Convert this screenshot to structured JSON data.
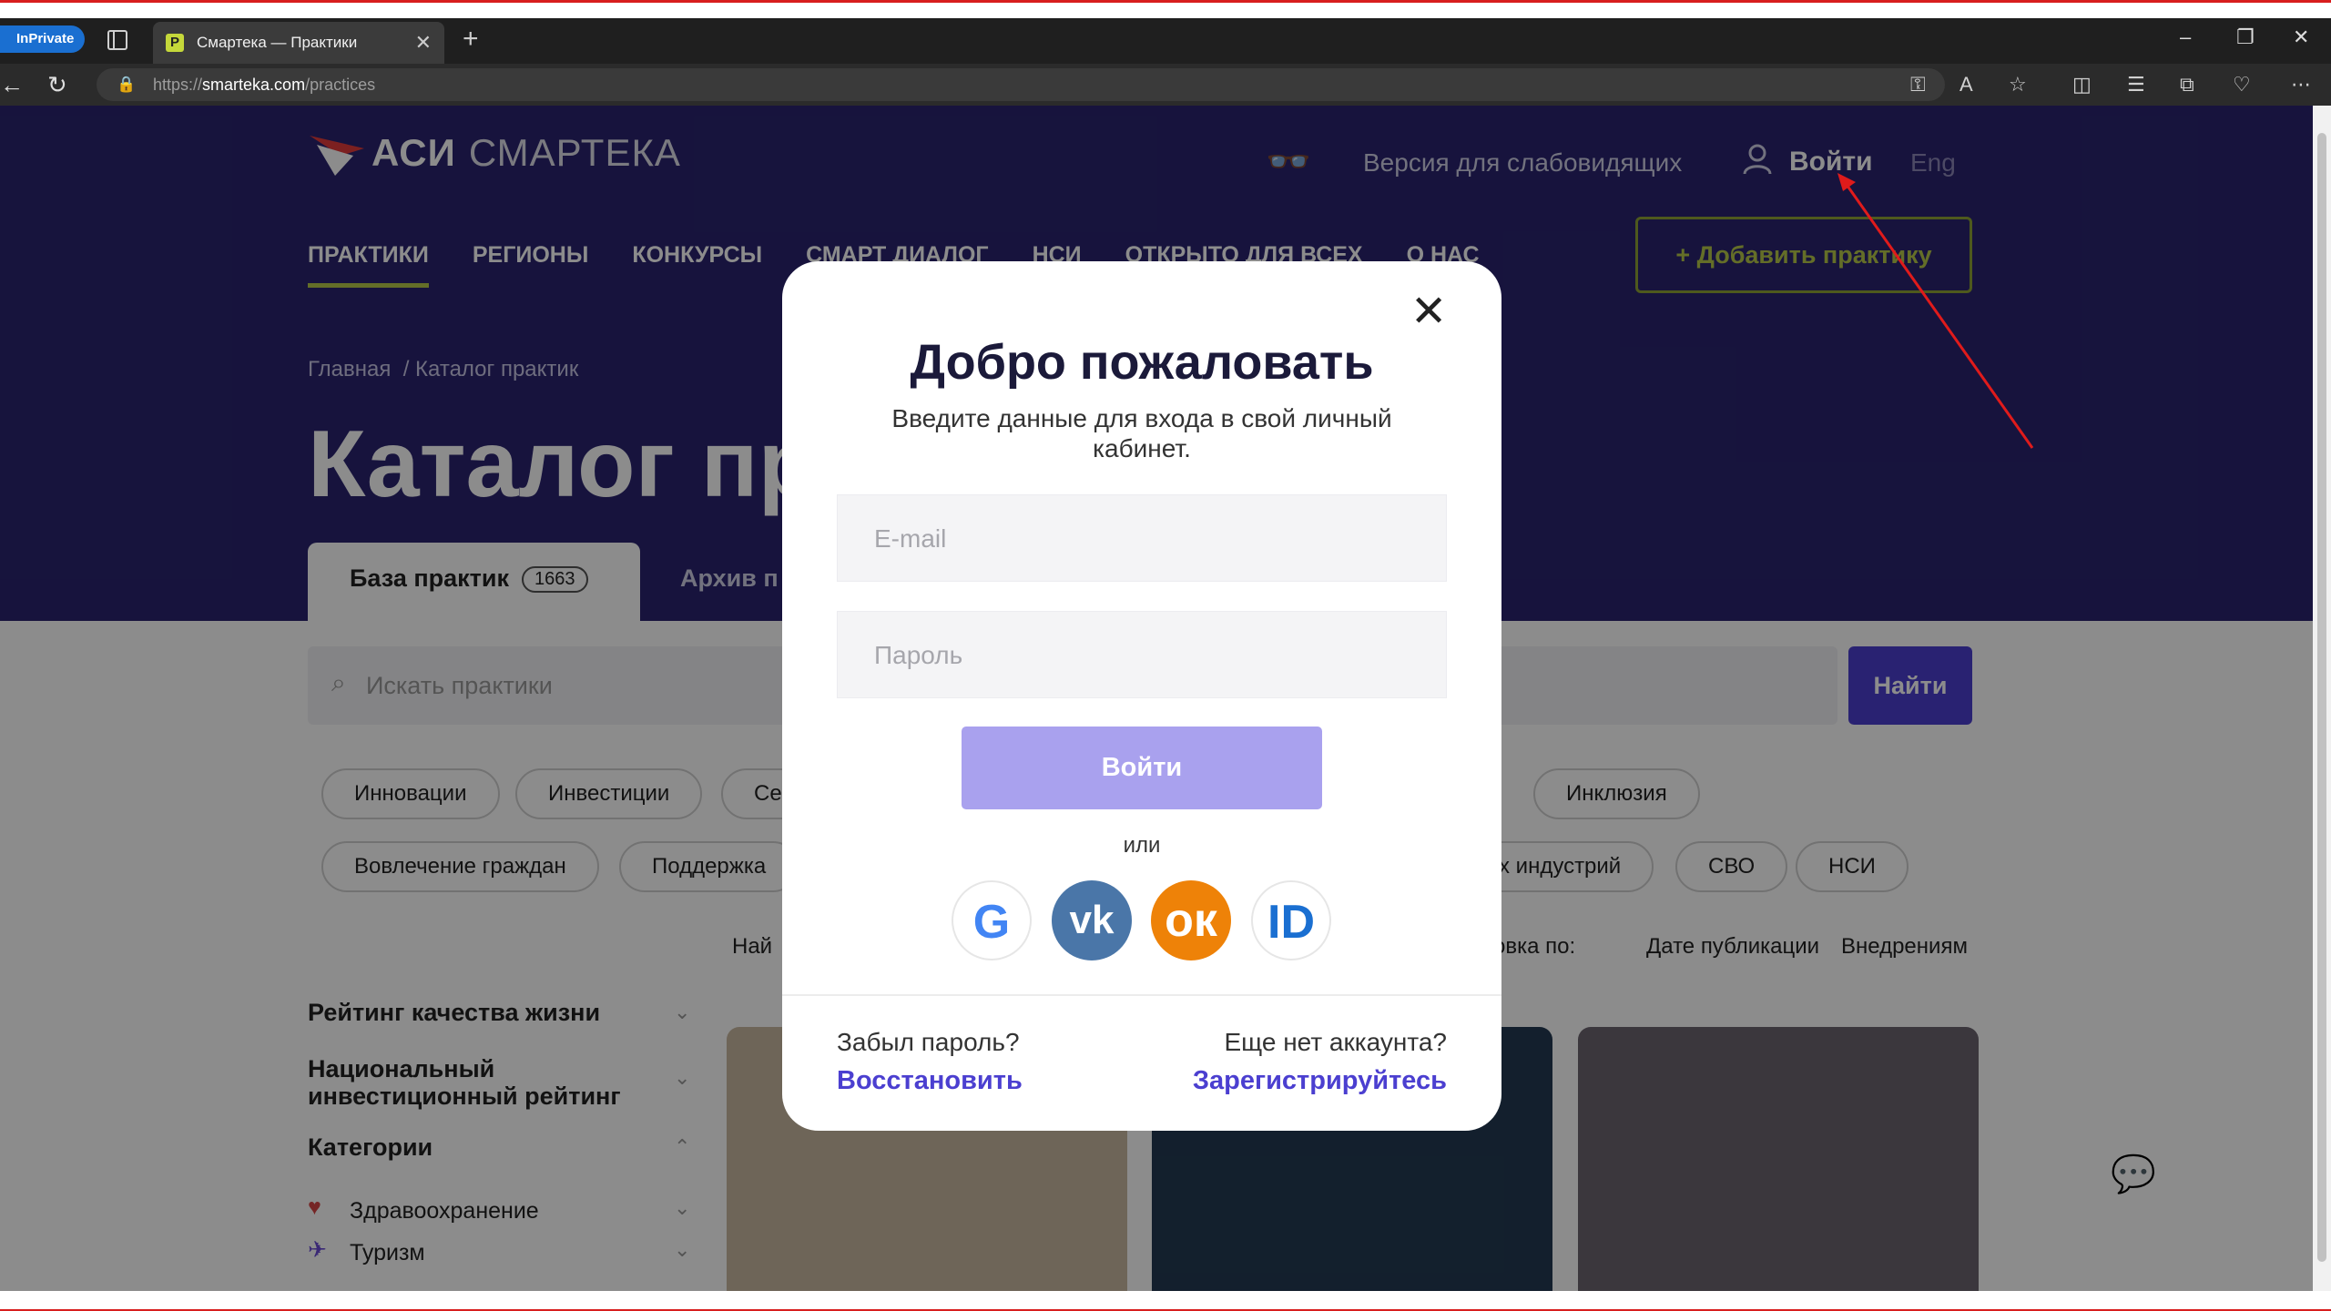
{
  "browser": {
    "inprivate_label": "InPrivate",
    "tab_title": "Смартека — Практики",
    "url_prefix": "https://",
    "url_host": "smarteka.com",
    "url_path": "/practices"
  },
  "header": {
    "logo_main": "АСИ",
    "logo_sub": "СМАРТЕКА",
    "accessibility_label": "Версия для слабовидящих",
    "login_label": "Войти",
    "lang_label": "Eng",
    "add_practice_label": "+ Добавить практику",
    "menu": [
      "ПРАКТИКИ",
      "РЕГИОНЫ",
      "КОНКУРСЫ",
      "СМАРТ ДИАЛОГ",
      "НСИ",
      "ОТКРЫТО ДЛЯ ВСЕХ",
      "О НАС"
    ]
  },
  "main": {
    "breadcrumb_home": "Главная",
    "breadcrumb_current": "/ Каталог практик",
    "title": "Каталог пр",
    "tab_base": "База практик",
    "tab_base_count": "1663",
    "tab_archive": "Архив п",
    "search_placeholder": "Искать практики",
    "search_button": "Найти",
    "chips_row1": [
      "Инновации",
      "Инвестиции",
      "Се",
      "Инклюзия"
    ],
    "chips_row2": [
      "Вовлечение граждан",
      "Поддержка",
      "х индустрий",
      "СВО",
      "НСИ"
    ],
    "found_prefix": "Най",
    "sort_label": "овка по:",
    "sort_date": "Дате публикации",
    "sort_impl": "Внедрениям"
  },
  "sidebar": {
    "rating_life": "Рейтинг качества жизни",
    "rating_invest": "Национальный инвестиционный рейтинг",
    "categories": "Категории",
    "cat_items": [
      "Здравоохранение",
      "Туризм"
    ]
  },
  "modal": {
    "title": "Добро пожаловать",
    "subtitle": "Введите данные для входа в свой личный кабинет.",
    "email_placeholder": "E-mail",
    "password_placeholder": "Пароль",
    "login_button": "Войти",
    "or_label": "или",
    "social": [
      "Google",
      "VK",
      "Одноклассники",
      "ID"
    ],
    "forgot_label": "Забыл пароль?",
    "restore_link": "Восстановить",
    "no_account_label": "Еще нет аккаунта?",
    "register_link": "Зарегистрируйтесь"
  },
  "colors": {
    "hero_bg": "#2a2470",
    "accent": "#4b3fd0",
    "login_btn": "#a9a1ee",
    "annotation_arrow": "#e01b1b"
  }
}
